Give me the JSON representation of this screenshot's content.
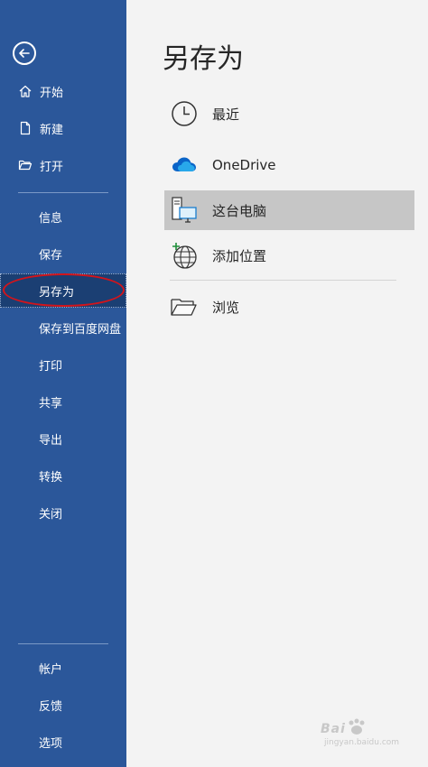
{
  "sidebar": {
    "back_icon": "arrow-left-circle-icon",
    "items": [
      {
        "label": "开始",
        "icon": "home-icon"
      },
      {
        "label": "新建",
        "icon": "new-document-icon"
      },
      {
        "label": "打开",
        "icon": "open-folder-icon"
      },
      {
        "label": "信息"
      },
      {
        "label": "保存"
      },
      {
        "label": "另存为",
        "active": true
      },
      {
        "label": "保存到百度网盘"
      },
      {
        "label": "打印"
      },
      {
        "label": "共享"
      },
      {
        "label": "导出"
      },
      {
        "label": "转换"
      },
      {
        "label": "关闭"
      }
    ],
    "footer_items": [
      {
        "label": "帐户"
      },
      {
        "label": "反馈"
      },
      {
        "label": "选项"
      }
    ],
    "colors": {
      "background": "#2b579a",
      "active": "#1b3f73",
      "annotation": "#d4141a"
    }
  },
  "main": {
    "title": "另存为",
    "locations": [
      {
        "label": "最近",
        "icon": "clock-icon"
      },
      {
        "label": "OneDrive",
        "icon": "cloud-icon"
      },
      {
        "label": "这台电脑",
        "icon": "computer-icon",
        "selected": true
      },
      {
        "label": "添加位置",
        "icon": "globe-add-icon"
      },
      {
        "label": "浏览",
        "icon": "folder-icon"
      }
    ]
  },
  "watermark": {
    "brand": "Bai",
    "sub": "jingyan.baidu.com"
  }
}
